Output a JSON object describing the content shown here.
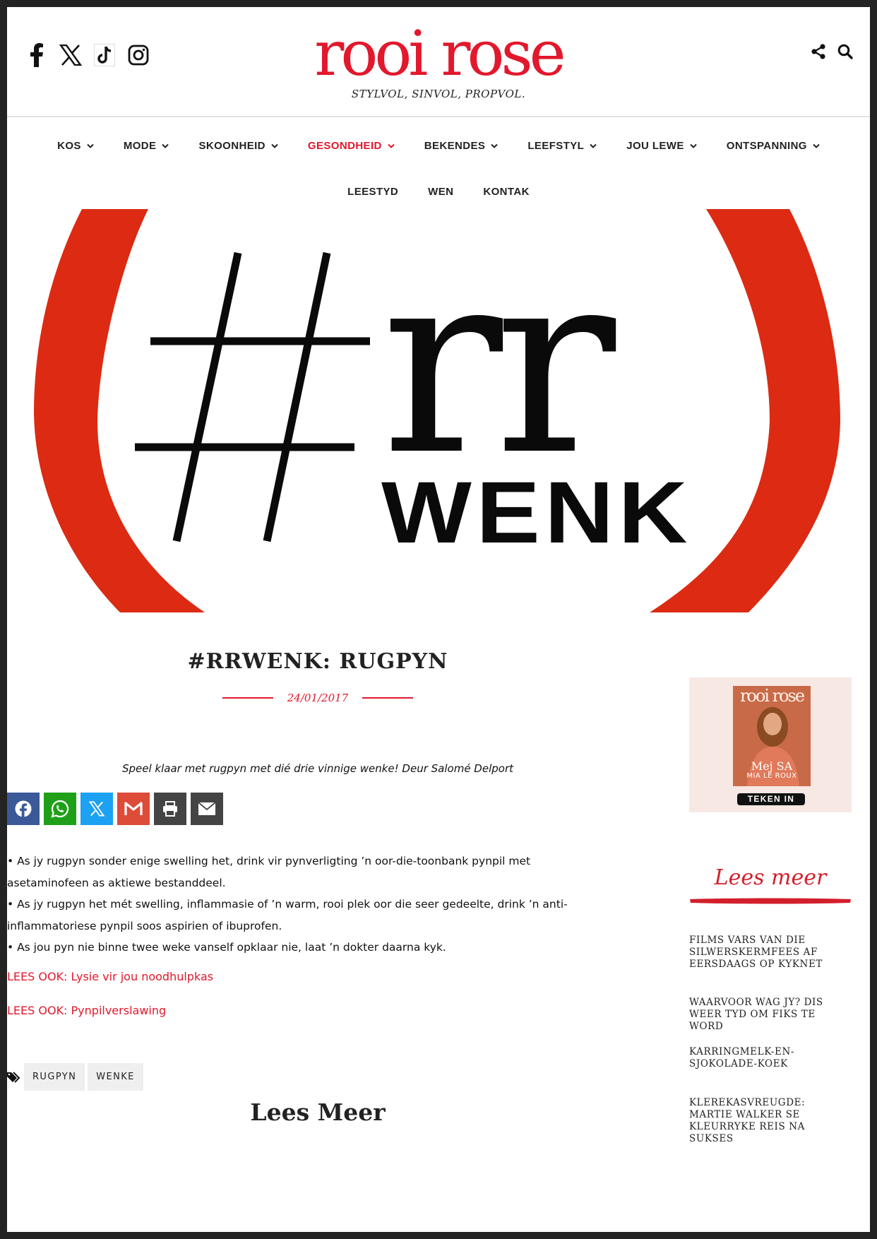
{
  "brand": {
    "logo": "rooi rose",
    "tagline": "STYLVOL, SINVOL, PROPVOL.",
    "accent_color": "#e2182c"
  },
  "header": {
    "social_icons": [
      "facebook-icon",
      "x-twitter-icon",
      "tiktok-icon",
      "instagram-icon"
    ],
    "tool_icons": [
      "share-icon",
      "search-icon"
    ]
  },
  "nav": {
    "row1": [
      {
        "label": "KOS"
      },
      {
        "label": "MODE"
      },
      {
        "label": "SKOONHEID"
      },
      {
        "label": "GESONDHEID"
      },
      {
        "label": "BEKENDES"
      },
      {
        "label": "LEEFSTYL"
      },
      {
        "label": "JOU LEWE"
      },
      {
        "label": "ONTSPANNING"
      }
    ],
    "row2": [
      {
        "label": "LEESTYD"
      },
      {
        "label": "WEN"
      },
      {
        "label": "KONTAK"
      }
    ],
    "active": "GESONDHEID"
  },
  "hero": {
    "hashtag": "#rr",
    "word": "WENK",
    "brush_color": "#dc2a13"
  },
  "article": {
    "title": "#RRWENK: RUGPYN",
    "date": "24/01/2017",
    "intro": "Speel klaar met rugpyn met dié drie vinnige wenke! Deur Salomé Delport",
    "share_buttons": [
      {
        "icon": "facebook-icon",
        "color": "#3b5998"
      },
      {
        "icon": "whatsapp-icon",
        "color": "#1fa018"
      },
      {
        "icon": "x-twitter-icon",
        "color": "#1da1f2"
      },
      {
        "icon": "gmail-icon",
        "color": "#dd4b39"
      },
      {
        "icon": "print-icon",
        "color": "#444444"
      },
      {
        "icon": "email-icon",
        "color": "#444444"
      }
    ],
    "bullets": [
      "• As jy rugpyn sonder enige swelling het, drink vir pynverligting ’n oor-die-toonbank pynpil met asetaminofeen as aktiewe bestanddeel.",
      "• As jy rugpyn het mét swelling, inflammasie of ’n warm, rooi plek oor die seer gedeelte, drink ’n anti-inflammatoriese pynpil soos aspirien of ibuprofen.",
      "• As jou pyn nie binne twee weke vanself opklaar nie, laat ’n dokter daarna kyk."
    ],
    "lees_ook": [
      "LEES OOK: Lysie vir jou noodhulpkas",
      "LEES OOK: Pynpilverslawing"
    ],
    "tags": [
      "RUGPYN",
      "WENKE"
    ],
    "lees_meer": "Lees Meer"
  },
  "sidebar": {
    "magazine": {
      "logo": "rooi rose",
      "name_line1": "Mej SA",
      "name_line2": "MIA LE ROUX",
      "button": "TEKEN IN"
    },
    "heading": "Lees meer",
    "links": [
      "FILMS VARS VAN DIE SILWERSKERMFEES AF EERSDAAGS OP KYKNET",
      "WAARVOOR WAG JY? DIS WEER TYD OM FIKS TE WORD",
      "KARRINGMELK-EN-SJOKOLADE-KOEK",
      "KLEREKASVREUGDE: MARTIE WALKER SE KLEURRYKE REIS NA SUKSES"
    ]
  }
}
